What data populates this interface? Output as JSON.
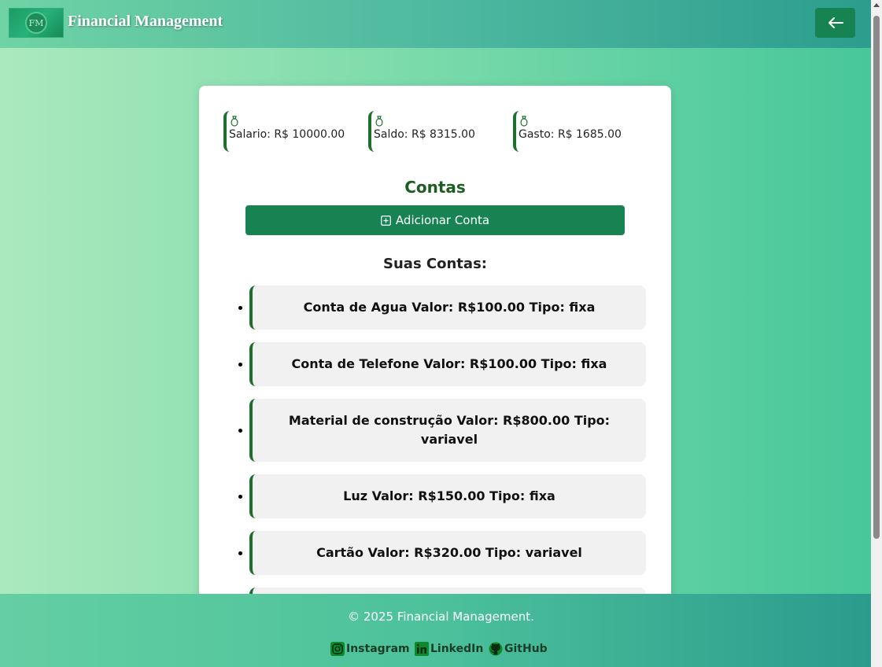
{
  "header": {
    "logo_text": "FM",
    "title": "Financial Management",
    "back_icon": "arrow-left-icon"
  },
  "summary": {
    "icon": "money-bag-icon",
    "items": [
      {
        "label": "Salario: R$ 10000.00"
      },
      {
        "label": "Saldo: R$ 8315.00"
      },
      {
        "label": "Gasto: R$ 1685.00"
      }
    ]
  },
  "accounts_section": {
    "title": "Contas",
    "add_button_label": "Adicionar Conta",
    "add_button_icon": "plus-square-icon",
    "list_title": "Suas Contas:",
    "items": [
      {
        "text": "Conta de Agua Valor: R$100.00 Tipo: fixa"
      },
      {
        "text": "Conta de Telefone Valor: R$100.00 Tipo: fixa"
      },
      {
        "text": "Material de construção Valor: R$800.00 Tipo: variavel"
      },
      {
        "text": "Luz Valor: R$150.00 Tipo: fixa"
      },
      {
        "text": "Cartão Valor: R$320.00 Tipo: variavel"
      },
      {
        "text": ""
      }
    ]
  },
  "footer": {
    "copyright": "© 2025 Financial Management.",
    "links": [
      {
        "label": "Instagram",
        "icon": "instagram-icon"
      },
      {
        "label": "LinkedIn",
        "icon": "linkedin-icon"
      },
      {
        "label": "GitHub",
        "icon": "github-icon"
      }
    ]
  },
  "colors": {
    "primary_green": "#188352",
    "accent_dark_green": "#1e6f2c",
    "title_green": "#1b5e20"
  }
}
